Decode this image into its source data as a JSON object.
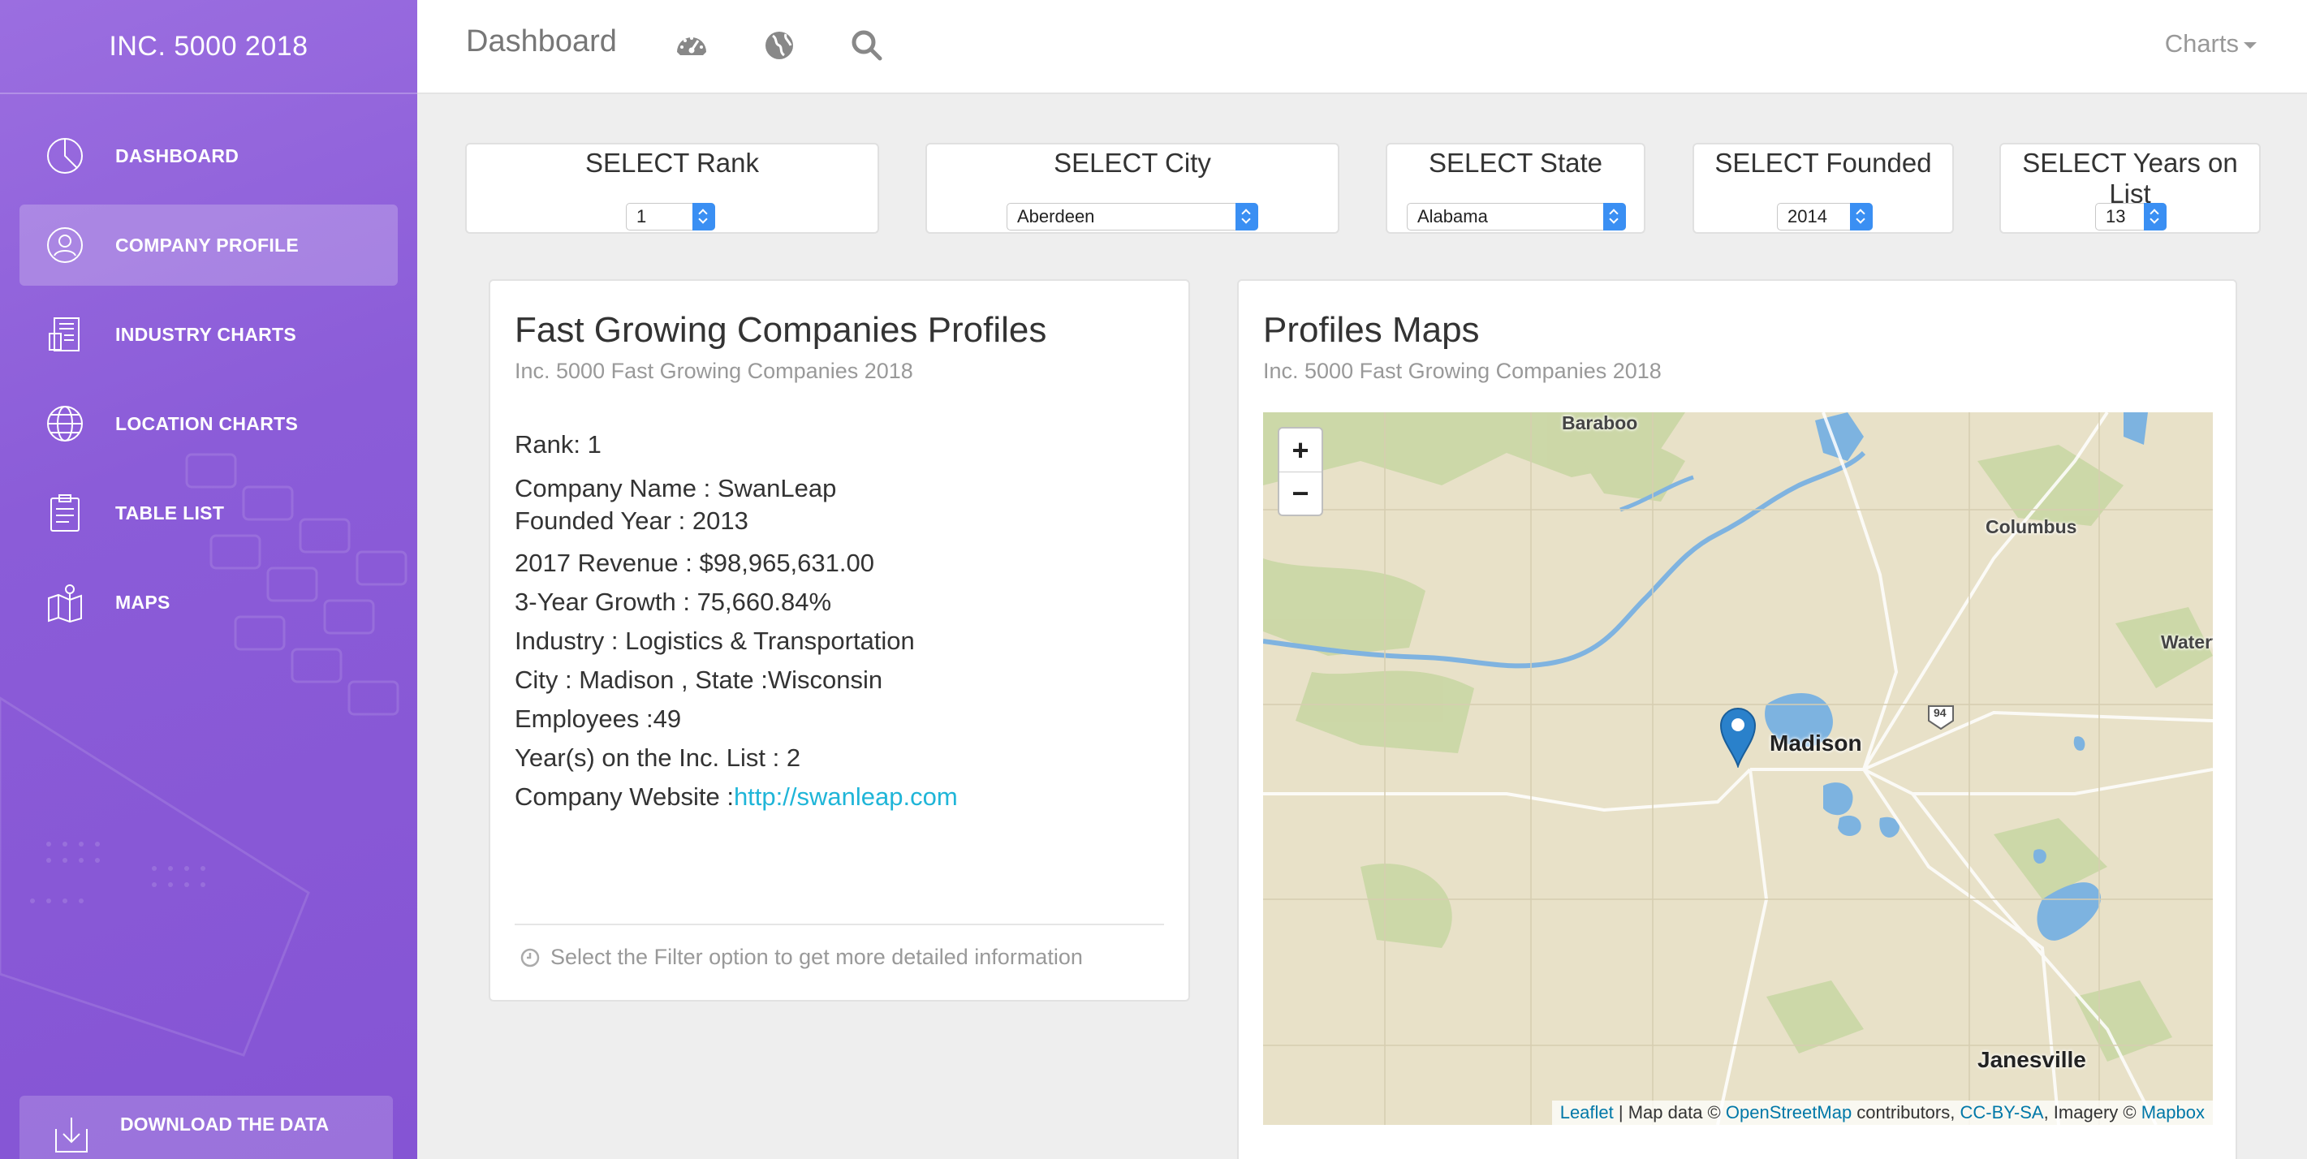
{
  "sidebar": {
    "brand": "INC. 5000 2018",
    "items": [
      {
        "label": "DASHBOARD",
        "icon": "pie-chart-icon",
        "active": false
      },
      {
        "label": "COMPANY PROFILE",
        "icon": "user-icon",
        "active": true
      },
      {
        "label": "INDUSTRY CHARTS",
        "icon": "document-icon",
        "active": false
      },
      {
        "label": "LOCATION CHARTS",
        "icon": "globe-icon",
        "active": false
      },
      {
        "label": "TABLE LIST",
        "icon": "clipboard-icon",
        "active": false
      },
      {
        "label": "MAPS",
        "icon": "map-icon",
        "active": false
      }
    ],
    "download_label": "DOWNLOAD THE DATA"
  },
  "topbar": {
    "title": "Dashboard",
    "icons": [
      "dashboard-icon",
      "globe-icon",
      "search-icon"
    ],
    "charts_menu": "Charts"
  },
  "filters": [
    {
      "label": "SELECT Rank",
      "value": "1"
    },
    {
      "label": "SELECT City",
      "value": "Aberdeen"
    },
    {
      "label": "SELECT State",
      "value": "Alabama"
    },
    {
      "label": "SELECT Founded",
      "value": "2014"
    },
    {
      "label": "SELECT Years on List",
      "value": "13"
    }
  ],
  "profile": {
    "title": "Fast Growing Companies Profiles",
    "subtitle": "Inc. 5000 Fast Growing Companies 2018",
    "rank": "Rank: 1",
    "company_name": "Company Name : SwanLeap",
    "founded": "Founded Year : 2013",
    "revenue": "2017 Revenue : $98,965,631.00",
    "growth": "3-Year Growth : 75,660.84%",
    "industry": "Industry : Logistics & Transportation",
    "location": "City : Madison , State :Wisconsin",
    "employees": "Employees :49",
    "years": "Year(s) on the Inc. List : 2",
    "website_label": "Company Website :",
    "website_url": "http://swanleap.com",
    "footer": "Select the Filter option to get more detailed information"
  },
  "maps": {
    "title": "Profiles Maps",
    "subtitle": "Inc. 5000 Fast Growing Companies 2018",
    "zoom_in": "+",
    "zoom_out": "−",
    "labels": {
      "baraboo": "Baraboo",
      "columbus": "Columbus",
      "watertown": "Watert",
      "madison": "Madison",
      "janesville": "Janesville",
      "highway": "94"
    },
    "attribution": {
      "leaflet": "Leaflet",
      "sep1": " | Map data © ",
      "osm": "OpenStreetMap",
      "sep2": " contributors, ",
      "license": "CC-BY-SA",
      "sep3": ", Imagery © ",
      "mapbox": "Mapbox"
    }
  },
  "colors": {
    "sidebar": "#8b5cd8",
    "accent_link": "#1fb5d8",
    "select_arrow": "#3a8ff3",
    "map_land": "#e7e0c6",
    "map_water": "#7db3e0",
    "map_marker": "#2a81cb"
  }
}
